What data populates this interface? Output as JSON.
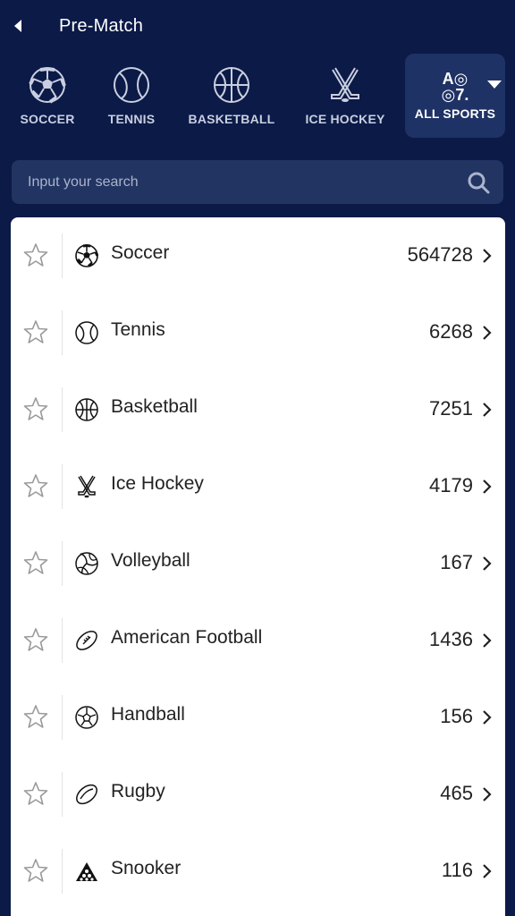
{
  "header": {
    "title": "Pre-Match",
    "back_icon": "chevron-left-icon"
  },
  "sports_bar": {
    "tabs": [
      {
        "label": "SOCCER",
        "icon": "soccer-ball-icon"
      },
      {
        "label": "TENNIS",
        "icon": "tennis-ball-icon"
      },
      {
        "label": "BASKETBALL",
        "icon": "basketball-icon"
      },
      {
        "label": "ICE HOCKEY",
        "icon": "hockey-sticks-icon"
      }
    ],
    "all": {
      "label": "ALL SPORTS",
      "glyph_top": "A◎",
      "glyph_bottom": "◎7.",
      "caret_icon": "caret-down-icon"
    }
  },
  "search": {
    "placeholder": "Input your search",
    "value": "",
    "icon": "search-icon"
  },
  "sports": [
    {
      "name": "Soccer",
      "count": "564728",
      "icon": "soccer-ball-icon"
    },
    {
      "name": "Tennis",
      "count": "6268",
      "icon": "tennis-ball-icon"
    },
    {
      "name": "Basketball",
      "count": "7251",
      "icon": "basketball-icon"
    },
    {
      "name": "Ice Hockey",
      "count": "4179",
      "icon": "hockey-sticks-icon"
    },
    {
      "name": "Volleyball",
      "count": "167",
      "icon": "volleyball-icon"
    },
    {
      "name": "American Football",
      "count": "1436",
      "icon": "american-football-icon"
    },
    {
      "name": "Handball",
      "count": "156",
      "icon": "handball-icon"
    },
    {
      "name": "Rugby",
      "count": "465",
      "icon": "rugby-ball-icon"
    },
    {
      "name": "Snooker",
      "count": "116",
      "icon": "snooker-icon"
    }
  ],
  "colors": {
    "background": "#0b1a47",
    "tab_active": "#1f3265",
    "search_bg": "#223462"
  }
}
